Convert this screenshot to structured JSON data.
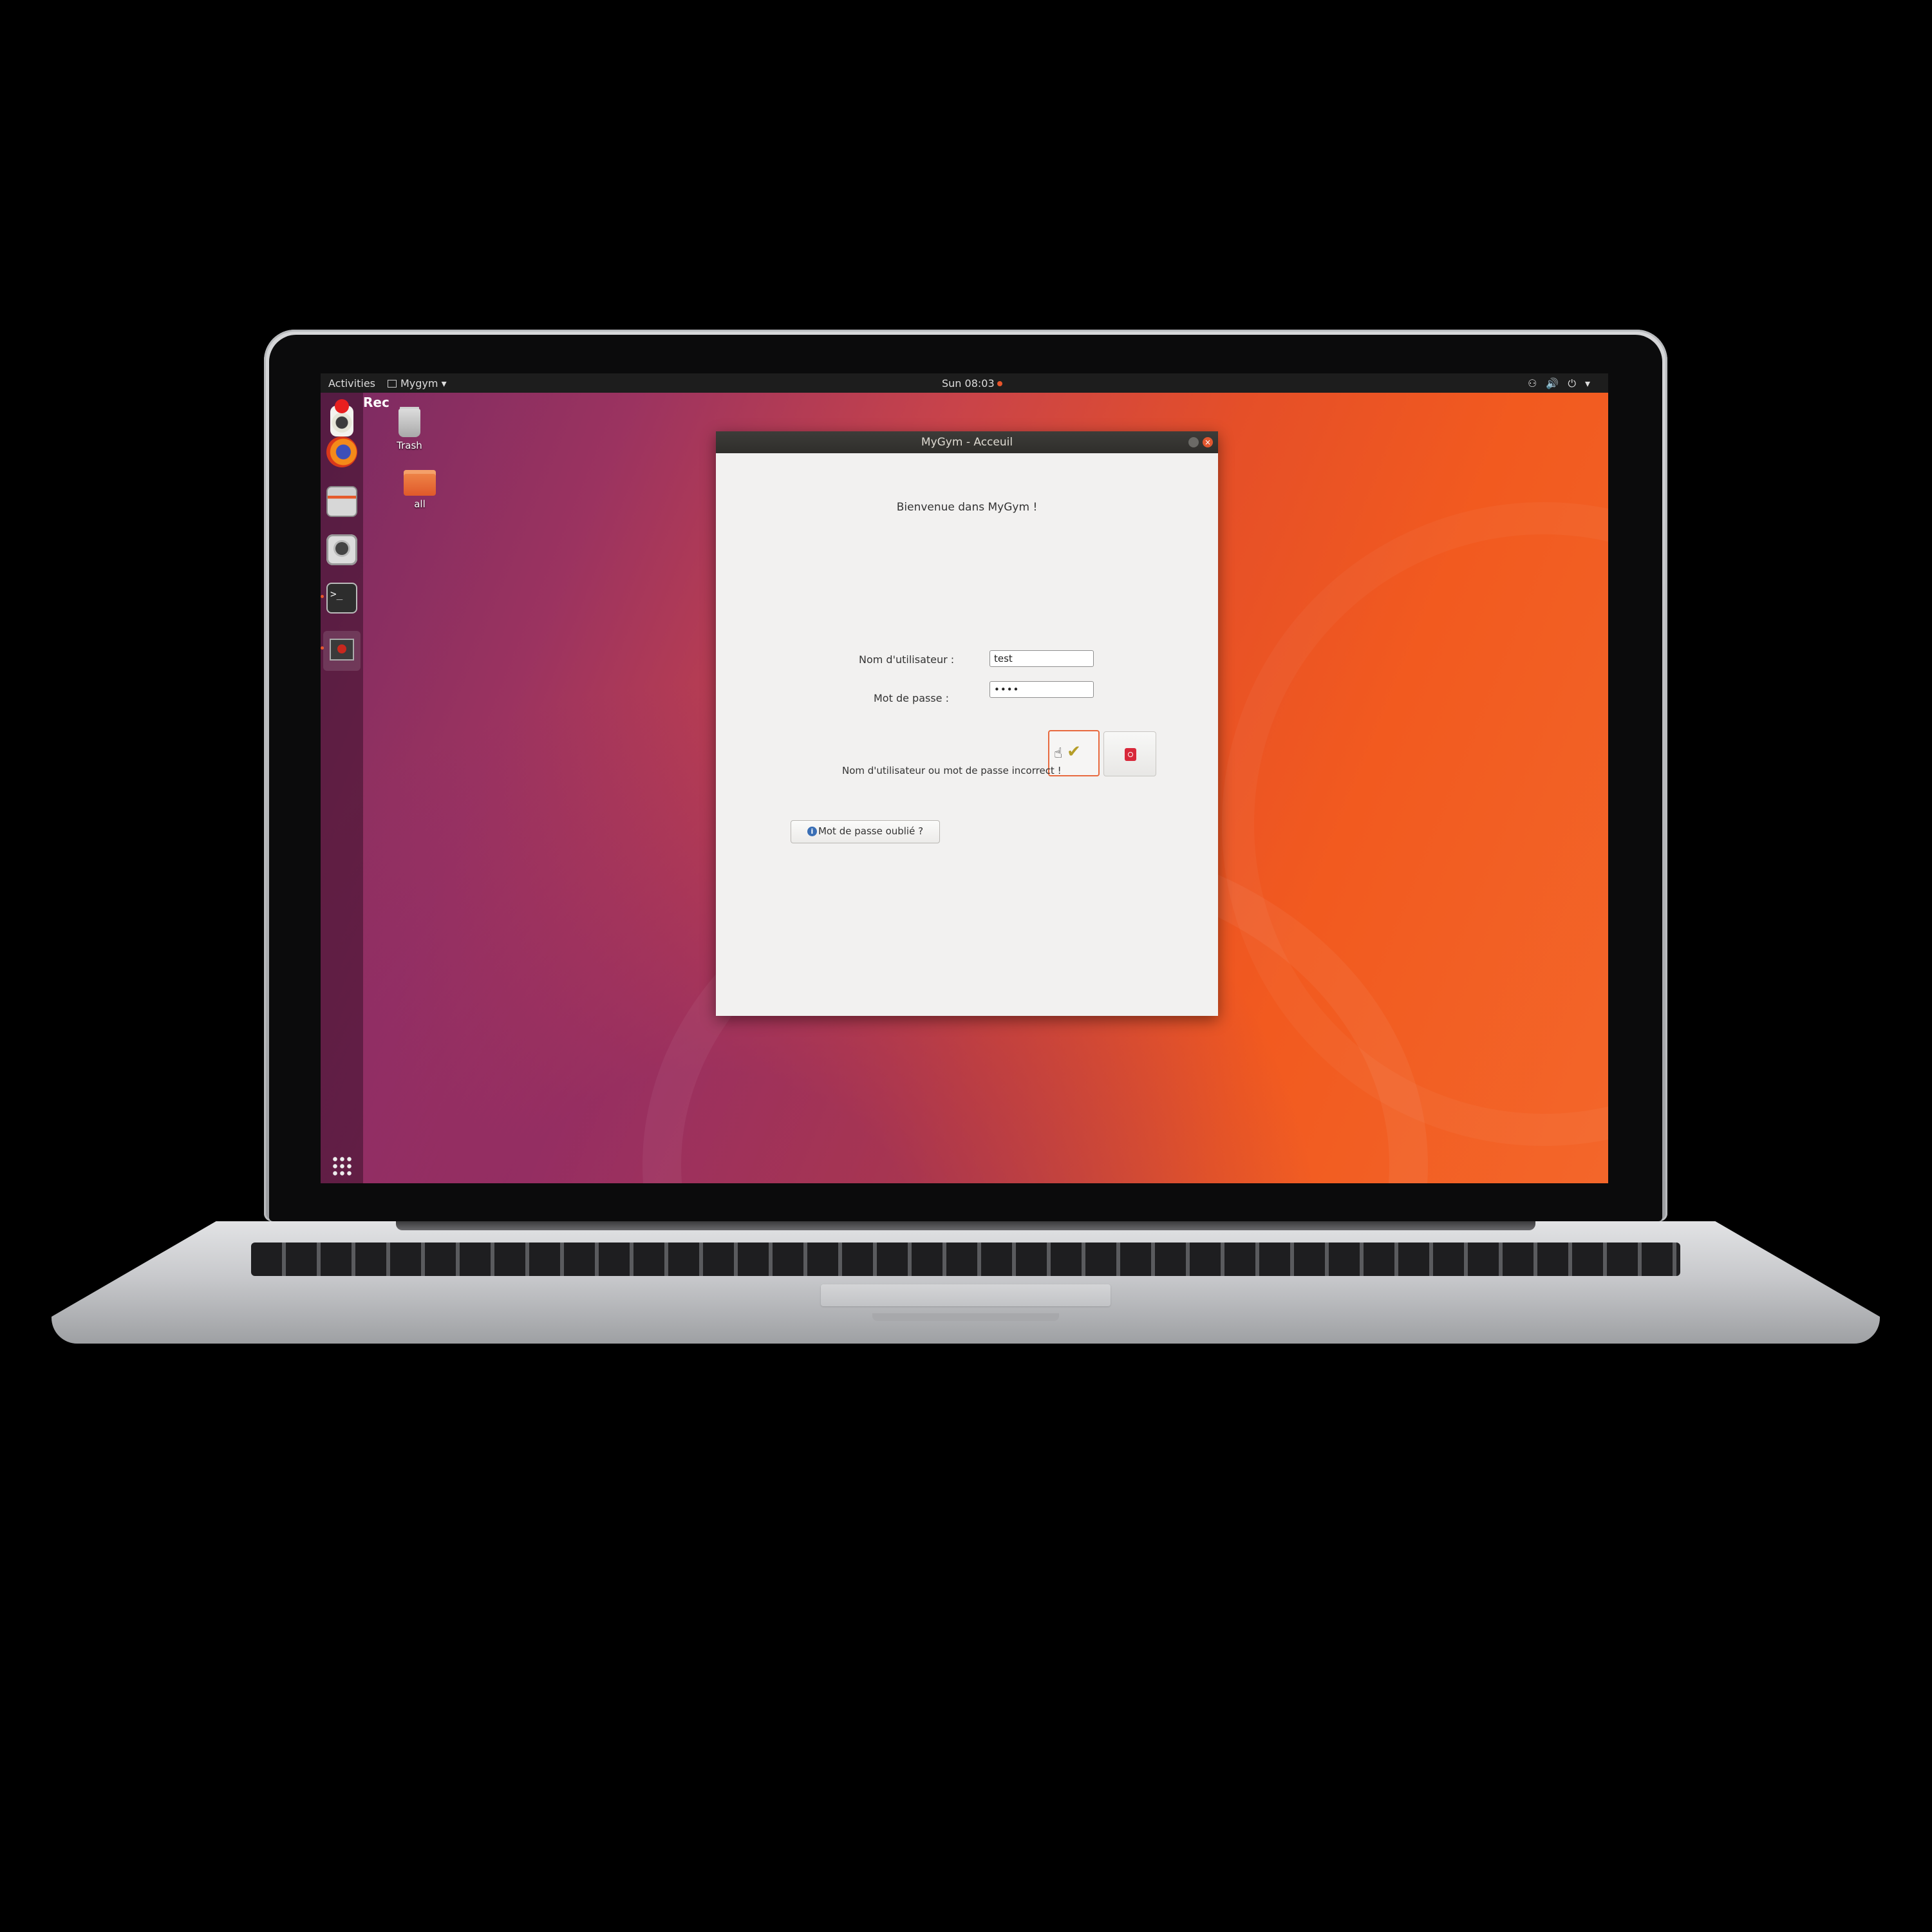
{
  "topbar": {
    "activities": "Activities",
    "app_menu": "Mygym ▾",
    "clock": "Sun 08:03",
    "tray": "⚇🔊⏻▾"
  },
  "desktop": {
    "rec_label": "Rec",
    "trash_label": "Trash",
    "folder_label": "all",
    "terminal_glyph": ">_"
  },
  "window": {
    "title": "MyGym - Acceuil",
    "close_glyph": "×",
    "welcome": "Bienvenue dans MyGym !",
    "username_label": "Nom d'utilisateur :",
    "username_value": "test",
    "password_label": "Mot de passe :",
    "password_value": "••••",
    "ok_glyph": "✔",
    "error_message": "Nom d'utilisateur ou mot de passe incorrect !",
    "forgot_label": "Mot de passe oublié ?",
    "info_glyph": "i",
    "cursor_glyph": "☝"
  },
  "colors": {
    "accent": "#e95420",
    "topbar_bg": "#1d1d1d",
    "window_bg": "#f2f1f0"
  }
}
